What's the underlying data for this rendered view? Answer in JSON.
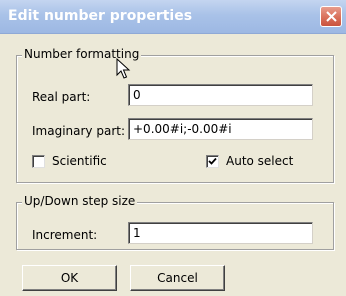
{
  "window": {
    "title": "Edit number properties",
    "close_icon": "close-icon"
  },
  "number_formatting": {
    "legend": "Number formatting",
    "real_label": "Real part:",
    "real_value": "0",
    "imaginary_label": "Imaginary part:",
    "imaginary_value": "+0.00#i;-0.00#i",
    "scientific_label": "Scientific",
    "scientific_checked": false,
    "auto_select_label": "Auto select",
    "auto_select_checked": true
  },
  "step_size": {
    "legend": "Up/Down step size",
    "increment_label": "Increment:",
    "increment_value": "1"
  },
  "buttons": {
    "ok": "OK",
    "cancel": "Cancel"
  },
  "colors": {
    "face": "#ECE9D8",
    "titlebar": "#A9C2E8",
    "close": "#D9705A"
  }
}
